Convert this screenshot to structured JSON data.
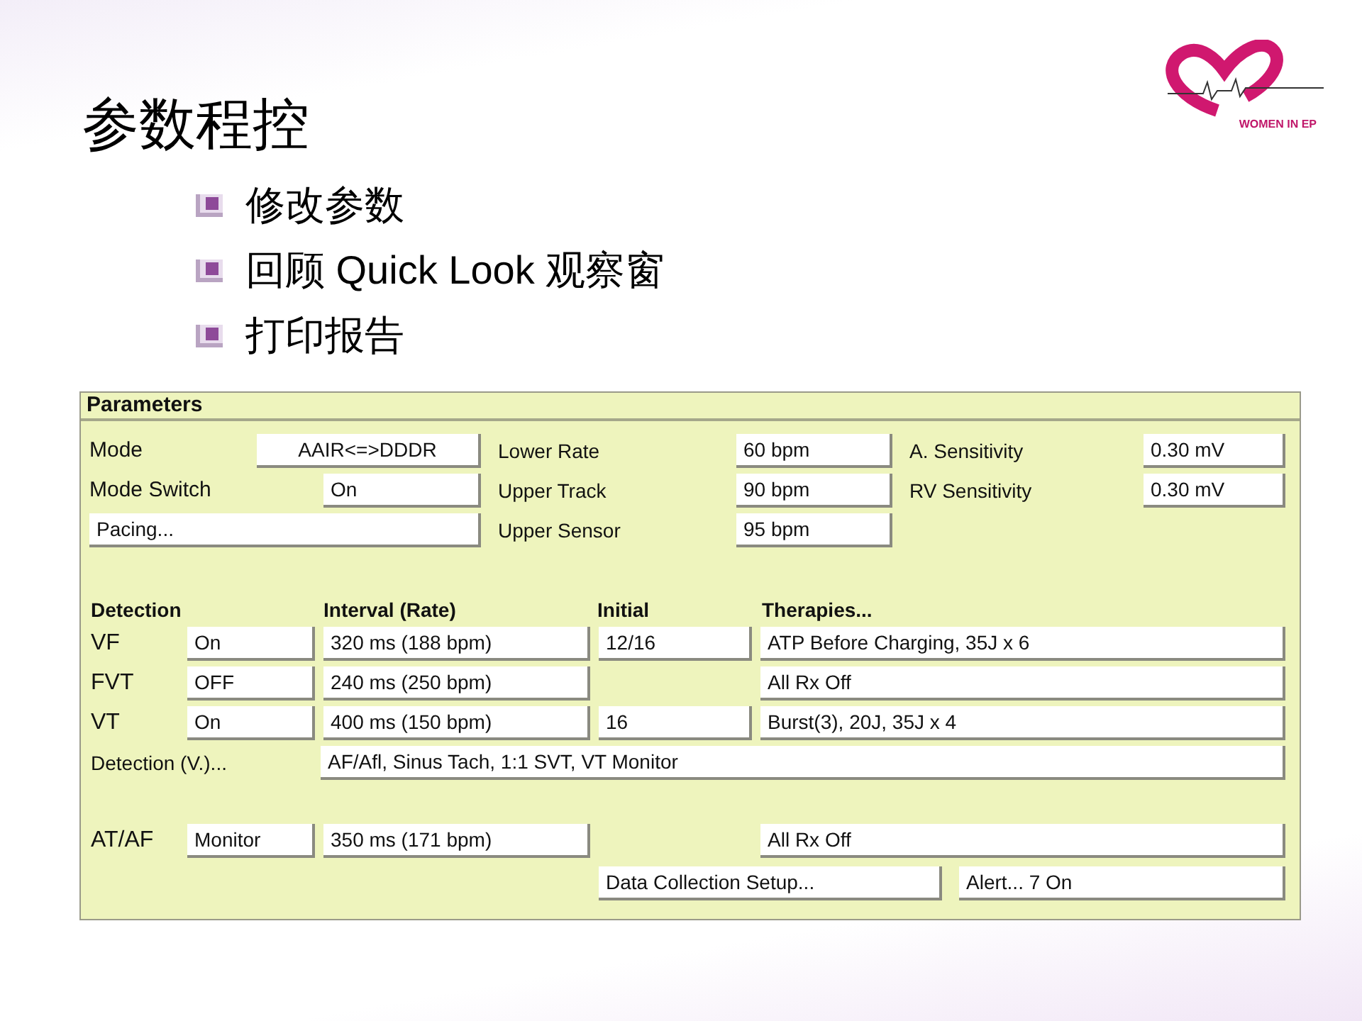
{
  "slide": {
    "title": "参数程控",
    "bullets": [
      "修改参数",
      "回顾 Quick Look 观察窗",
      "打印报告"
    ],
    "logo_text": "WOMEN IN EP"
  },
  "panel": {
    "title": "Parameters",
    "top": [
      {
        "left": {
          "label": "Mode",
          "value": "AAIR<=>DDDR"
        },
        "mid": {
          "label": "Lower Rate",
          "value": "60 bpm"
        },
        "right": {
          "label": "A. Sensitivity",
          "value": "0.30 mV"
        }
      },
      {
        "left": {
          "label": "Mode Switch",
          "value": "On"
        },
        "mid": {
          "label": "Upper Track",
          "value": "90 bpm"
        },
        "right": {
          "label": "RV Sensitivity",
          "value": "0.30 mV"
        }
      },
      {
        "left": {
          "button": "Pacing..."
        },
        "mid": {
          "label": "Upper Sensor",
          "value": "95 bpm"
        }
      }
    ],
    "headers": [
      "Detection",
      "Interval (Rate)",
      "Initial",
      "Therapies..."
    ],
    "zones": [
      {
        "label": "VF",
        "status": "On",
        "interval": "320 ms (188 bpm)",
        "initial": "12/16",
        "therapy": "ATP Before Charging, 35J x 6"
      },
      {
        "label": "FVT",
        "status": "OFF",
        "interval": "240 ms (250 bpm)",
        "therapy": "All Rx Off"
      },
      {
        "label": "VT",
        "status": "On",
        "interval": "400 ms (150 bpm)",
        "initial": "16",
        "therapy": "Burst(3), 20J, 35J x 4"
      }
    ],
    "detection": {
      "label": "Detection (V.)...",
      "value": "AF/Afl, Sinus Tach, 1:1 SVT, VT Monitor"
    },
    "atrial": {
      "label": "AT/AF",
      "status": "Monitor",
      "interval": "350 ms (171 bpm)",
      "therapy": "All Rx Off"
    },
    "buttons": [
      "Data Collection Setup...",
      "Alert... 7 On"
    ]
  }
}
